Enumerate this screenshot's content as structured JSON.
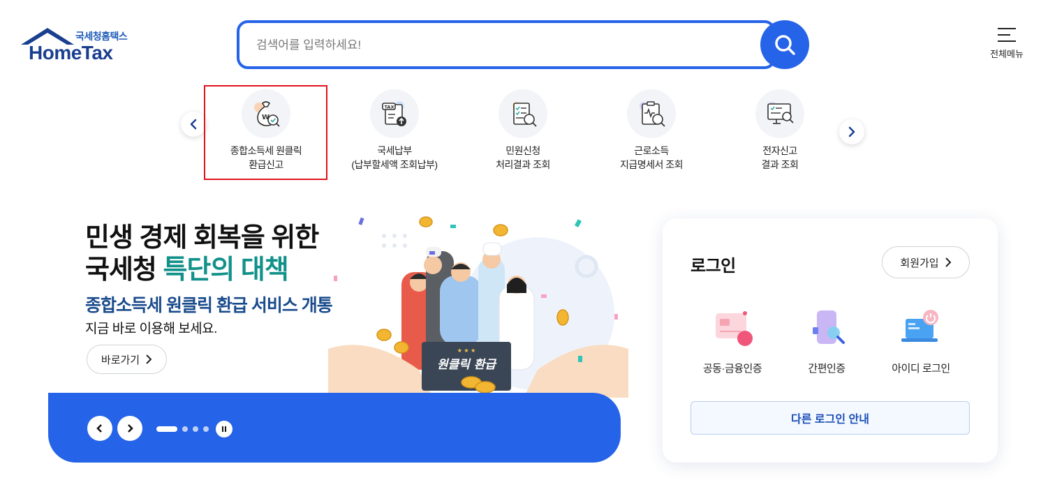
{
  "header": {
    "logo_sub": "국세청홈택스",
    "logo_main": "HomeTax",
    "search_placeholder": "검색어를 입력하세요!",
    "menu_label": "전체메뉴"
  },
  "quick_menu": {
    "items": [
      {
        "line1": "종합소득세 원클릭",
        "line2": "환급신고",
        "icon": "money-bag-check-icon"
      },
      {
        "line1": "국세납부",
        "line2": "(납부할세액 조회납부)",
        "icon": "tax-document-upload-icon"
      },
      {
        "line1": "민원신청",
        "line2": "처리결과 조회",
        "icon": "checklist-search-icon"
      },
      {
        "line1": "근로소득",
        "line2": "지급명세서 조회",
        "icon": "clipboard-search-icon"
      },
      {
        "line1": "전자신고",
        "line2": "결과 조회",
        "icon": "monitor-search-icon"
      }
    ]
  },
  "banner": {
    "title_line1": "민생 경제 회복을 위한",
    "title_line2_prefix": "국세청 ",
    "title_line2_accent": "특단의 대책",
    "subtitle": "종합소득세 원클릭 환급 서비스 개통",
    "description": "지금 바로 이용해 보세요.",
    "go_button": "바로가기",
    "sign_text": "원클릭 환급",
    "slide_count": 4,
    "active_slide": 1
  },
  "login": {
    "title": "로그인",
    "signup_label": "회원가입",
    "options": [
      {
        "label": "공동·금융인증",
        "icon": "certificate-card-icon"
      },
      {
        "label": "간편인증",
        "icon": "phone-search-icon"
      },
      {
        "label": "아이디 로그인",
        "icon": "laptop-power-icon"
      }
    ],
    "other_login_label": "다른 로그인 안내"
  },
  "colors": {
    "primary": "#2563e8",
    "accent_teal": "#12918a",
    "subtitle_navy": "#1a4b8c",
    "highlight_red": "#e0121b"
  }
}
